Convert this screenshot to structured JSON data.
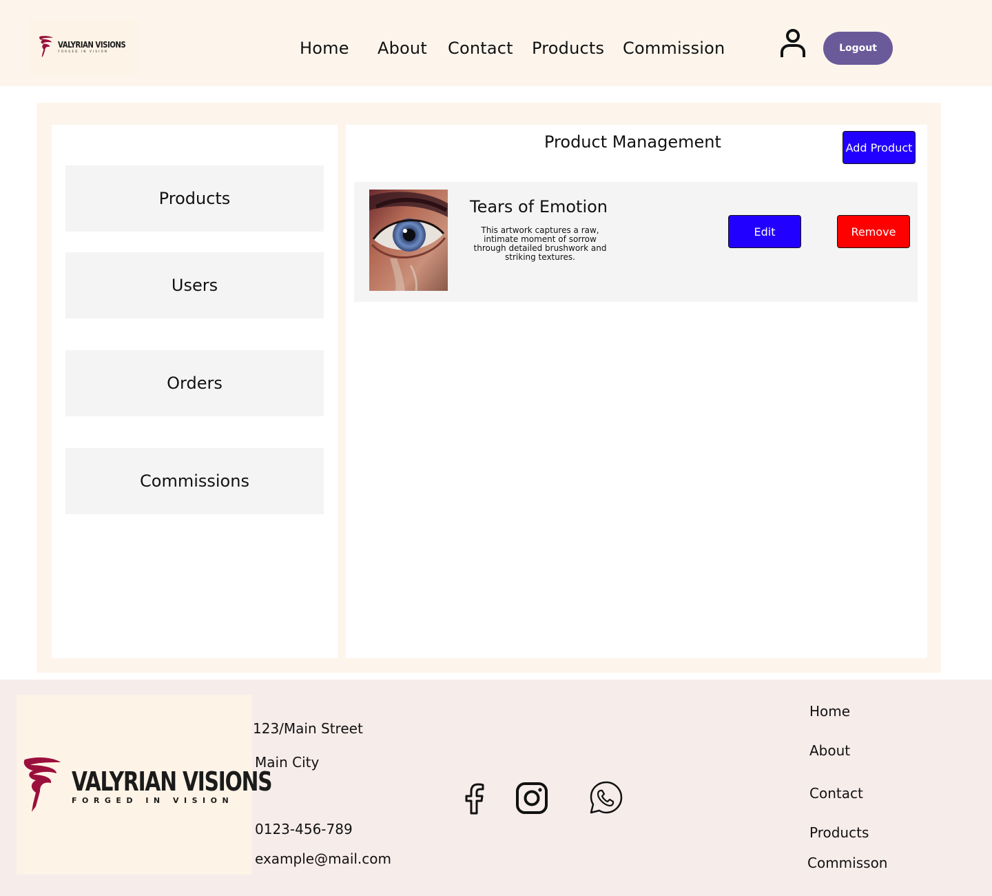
{
  "header": {
    "logo": {
      "brand": "VALYRIAN VISIONS",
      "tagline": "FORGED IN VISION"
    },
    "nav": [
      "Home",
      "About",
      "Contact",
      "Products",
      "Commission"
    ],
    "logout_label": "Logout",
    "icons": {
      "user": "user-icon"
    }
  },
  "sidebar": {
    "items": [
      {
        "label": "Products"
      },
      {
        "label": "Users"
      },
      {
        "label": "Orders"
      },
      {
        "label": "Commissions"
      }
    ]
  },
  "content": {
    "title": "Product Management",
    "add_button": "Add Product",
    "products": [
      {
        "name": "Tears of Emotion",
        "description": "This artwork captures a raw, intimate moment of sorrow through detailed brushwork and striking textures.",
        "edit_label": "Edit",
        "remove_label": "Remove"
      }
    ]
  },
  "footer": {
    "logo": {
      "brand": "VALYRIAN VISIONS",
      "tagline": "FORGED IN VISION"
    },
    "address_line1": "123/Main Street",
    "address_line2": "Main City",
    "phone": "0123-456-789",
    "email": "example@mail.com",
    "social_icons": [
      "facebook-icon",
      "instagram-icon",
      "whatsapp-icon"
    ],
    "links": [
      "Home",
      "About",
      "Contact",
      "Products",
      "Commisson"
    ]
  },
  "colors": {
    "header_bg": "#fdf5ec",
    "logout_bg": "#6a5a9a",
    "primary_blue": "#2200ff",
    "danger_red": "#ff0000",
    "panel_gray": "#f4f4f4",
    "footer_bg": "#f6ecea",
    "brand_crimson": "#9b0f3c"
  }
}
